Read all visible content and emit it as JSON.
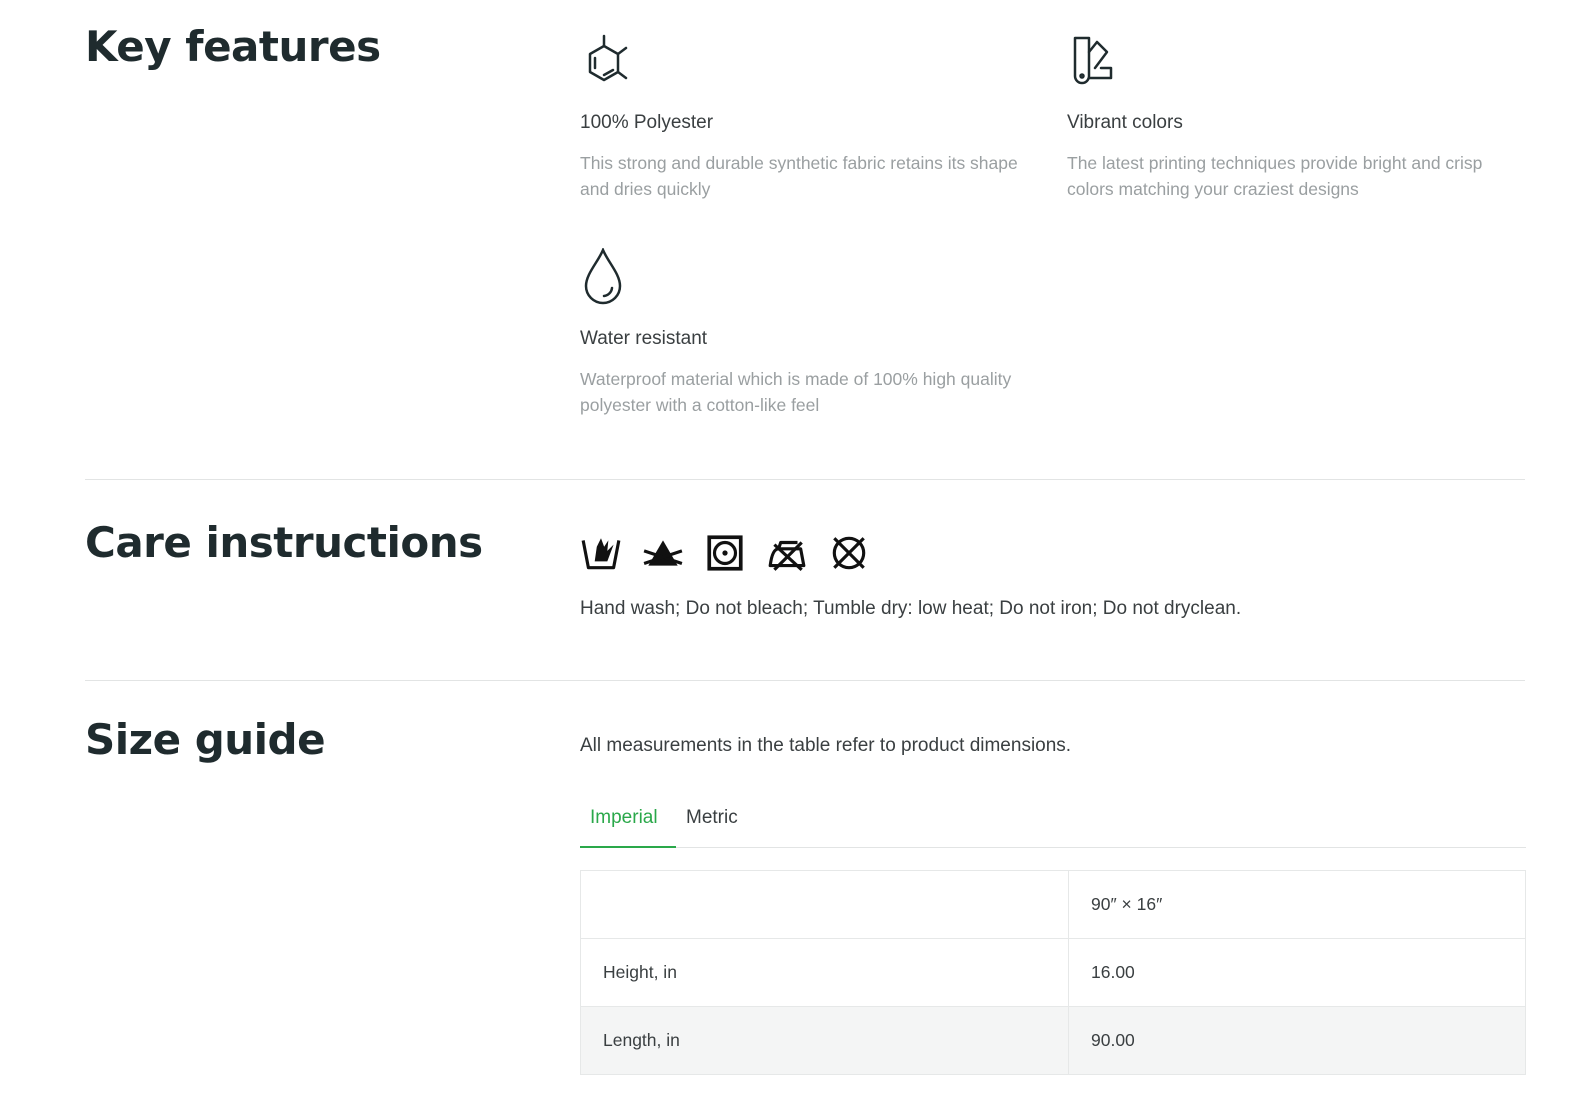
{
  "key_features": {
    "title": "Key features",
    "items": [
      {
        "icon": "polyester-molecule-icon",
        "title": "100% Polyester",
        "description": "This strong and durable synthetic fabric retains its shape and dries quickly"
      },
      {
        "icon": "vibrant-colors-icon",
        "title": "Vibrant colors",
        "description": "The latest printing techniques provide bright and crisp colors matching your craziest designs"
      },
      {
        "icon": "water-drop-icon",
        "title": "Water resistant",
        "description": "Waterproof material which is made of 100% high quality polyester with a cotton-like feel"
      }
    ]
  },
  "care": {
    "title": "Care instructions",
    "icons": [
      "hand-wash-icon",
      "do-not-bleach-icon",
      "tumble-dry-low-icon",
      "do-not-iron-icon",
      "do-not-dryclean-icon"
    ],
    "text": "Hand wash; Do not bleach; Tumble dry: low heat; Do not iron; Do not dryclean."
  },
  "size_guide": {
    "title": "Size guide",
    "intro": "All measurements in the table refer to product dimensions.",
    "tabs": [
      {
        "label": "Imperial",
        "active": true
      },
      {
        "label": "Metric",
        "active": false
      }
    ],
    "table": {
      "header": [
        "",
        "90″ × 16″"
      ],
      "rows": [
        [
          "Height, in",
          "16.00"
        ],
        [
          "Length, in",
          "90.00"
        ]
      ]
    }
  },
  "colors": {
    "accent": "#2aa84a",
    "heading": "#1f2b2e",
    "muted": "#9a9fa1"
  }
}
